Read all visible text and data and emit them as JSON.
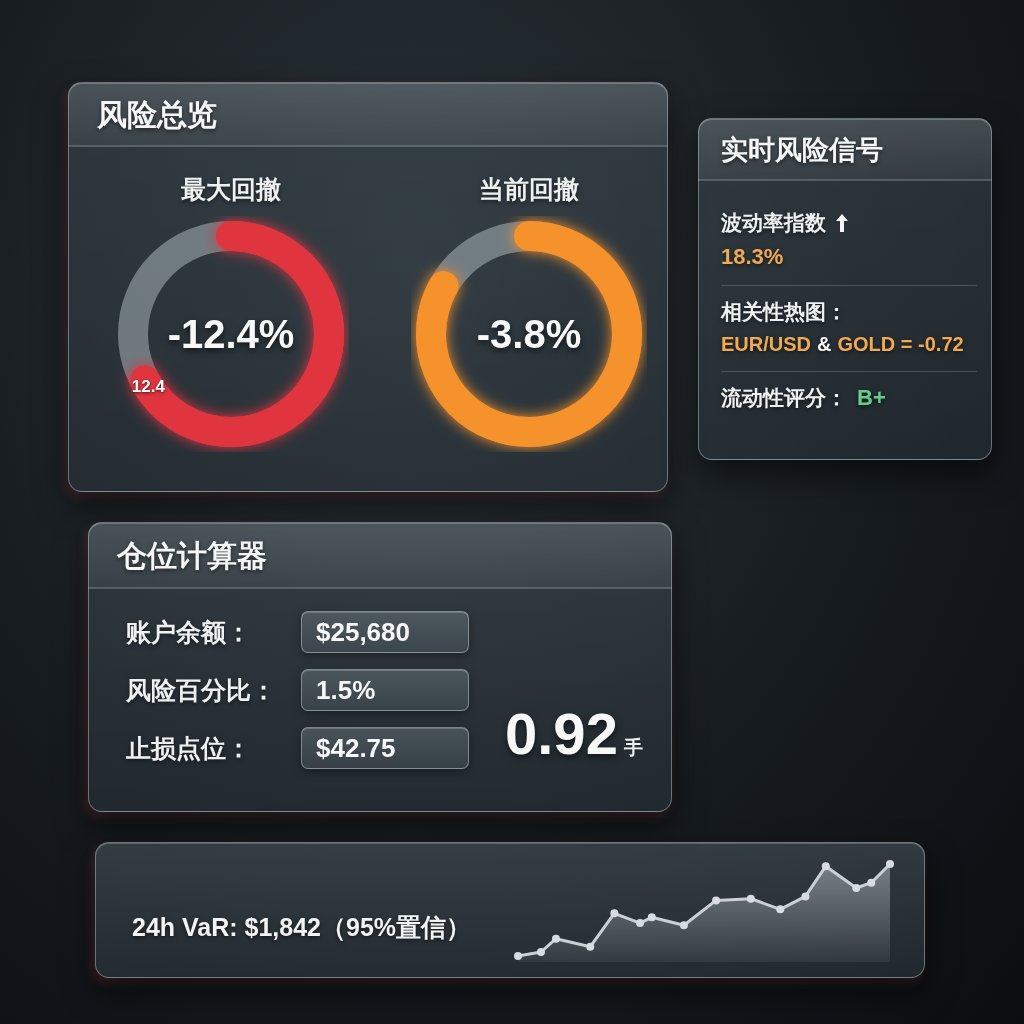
{
  "overview": {
    "title": "风险总览",
    "gauges": [
      {
        "label": "最大回撤",
        "value": "-12.4%",
        "level": 0.67,
        "color": "#e0343f",
        "end_label": "12.4"
      },
      {
        "label": "当前回撤",
        "value": "-3.8%",
        "level": 0.83,
        "color": "#f5922c"
      }
    ]
  },
  "signals": {
    "title": "实时风险信号",
    "items": [
      {
        "kind": "trend",
        "label": "波动率指数",
        "value": "18.3%",
        "color": "#f2aa52"
      },
      {
        "kind": "pair",
        "label": "相关性热图：",
        "parts": [
          {
            "text": "EUR/USD",
            "highlight": true
          },
          {
            "text": "&",
            "highlight": false
          },
          {
            "text": "GOLD = -0.72",
            "highlight": true
          }
        ],
        "color": "#f2aa52"
      },
      {
        "kind": "grade",
        "label": "流动性评分：",
        "value": "B+",
        "color": "#62d08a"
      }
    ]
  },
  "calculator": {
    "title": "仓位计算器",
    "fields": [
      {
        "label": "账户余额：",
        "value": "$25,680"
      },
      {
        "label": "风险百分比：",
        "value": "1.5%"
      },
      {
        "label": "止损点位：",
        "value": "$42.75"
      }
    ],
    "result": {
      "value": "0.92",
      "unit": "手"
    }
  },
  "var_bar": {
    "text": "24h VaR: $1,842（95%置信）"
  }
}
